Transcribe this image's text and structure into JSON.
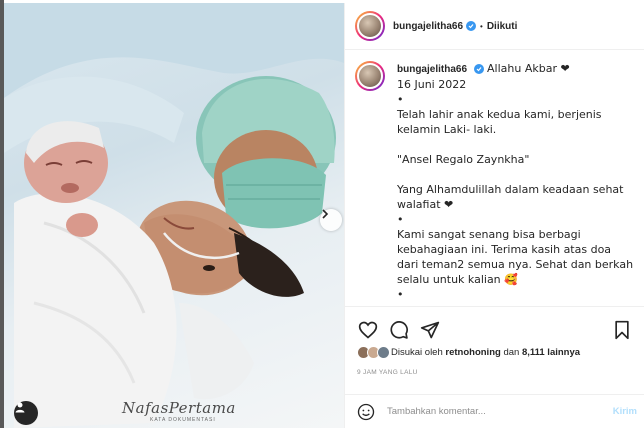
{
  "post": {
    "username": "bungajelitha66",
    "follow_status": "Diikuti",
    "separator": "•",
    "watermark": "NafasPertama",
    "watermark_sub": "KATA DOKUMENTASI"
  },
  "caption": {
    "username": "bungajelitha66",
    "lines": [
      "Allahu Akbar ❤",
      "16 Juni 2022",
      "•",
      "Telah lahir anak kedua kami, berjenis",
      "kelamin Laki- laki.",
      "",
      "\"Ansel Regalo Zaynkha\"",
      "",
      "Yang Alhamdulillah dalam keadaan sehat",
      "walafiat ❤",
      "•",
      "Kami sangat senang bisa berbagi",
      "kebahagiaan ini. Terima kasih atas doa",
      "dari teman2 semua nya. Sehat dan berkah",
      "selalu untuk kalian 🥰",
      "•"
    ]
  },
  "likes": {
    "prefix": "Disukai oleh",
    "user": "retnohoning",
    "conjunction": "dan",
    "count": "8,111 lainnya"
  },
  "timestamp": "9 JAM YANG LALU",
  "comment": {
    "placeholder": "Tambahkan komentar...",
    "send_label": "Kirim"
  },
  "icons": [
    "heart-icon",
    "comment-icon",
    "share-icon",
    "bookmark-icon",
    "emoji-icon",
    "chevron-right-icon",
    "user-tag-icon",
    "verified-icon"
  ],
  "colors": {
    "verified": "#3897f0",
    "send_disabled": "#b2dffc",
    "heart": "#e0245e"
  }
}
